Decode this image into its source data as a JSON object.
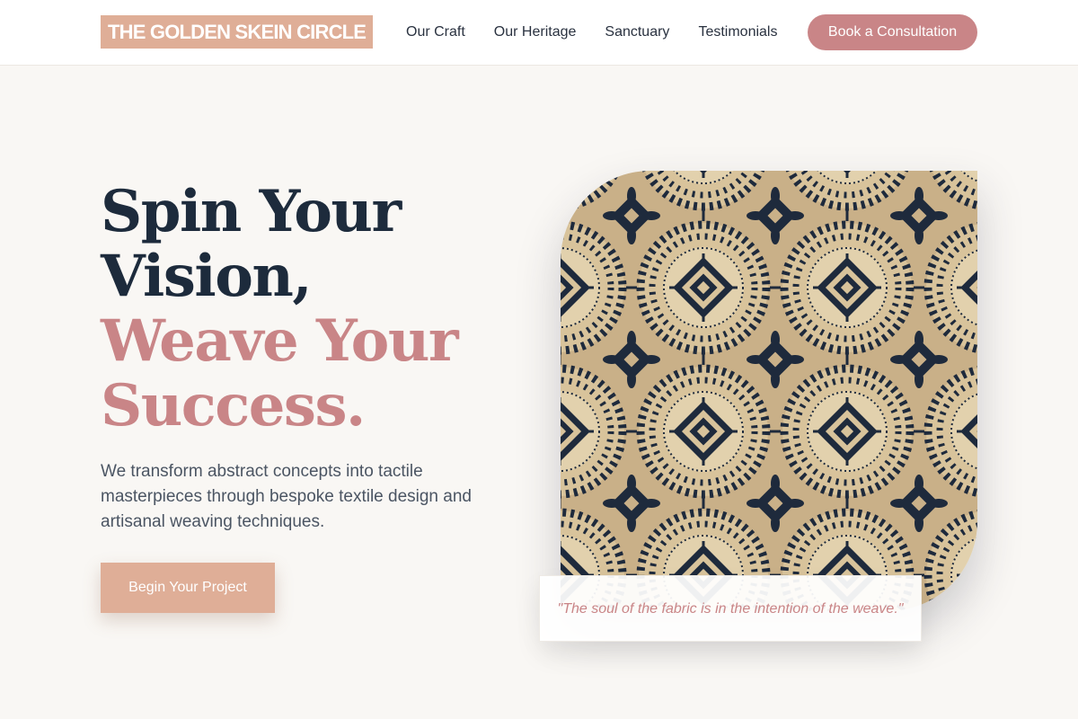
{
  "brand": {
    "name": "THE GOLDEN SKEIN CIRCLE"
  },
  "nav": {
    "items": [
      "Our Craft",
      "Our Heritage",
      "Sanctuary",
      "Testimonials"
    ],
    "cta_label": "Book a Consultation"
  },
  "hero": {
    "headline_dark_1": "Spin Your",
    "headline_dark_2": "Vision,",
    "headline_rose_1": "Weave Your",
    "headline_rose_2": "Success.",
    "description": "We transform abstract concepts into tactile masterpieces through bespoke textile design and artisanal weaving techniques.",
    "cta_label": "Begin Your Project",
    "quote": "\"The soul of the fabric is in the intention of the weave.\""
  },
  "colors": {
    "accent_rose": "#c98587",
    "accent_sand": "#dfae97",
    "navy": "#1d2b3c",
    "background": "#f9f7f4"
  },
  "icons": {
    "pattern_image": "damask-textile-pattern"
  }
}
